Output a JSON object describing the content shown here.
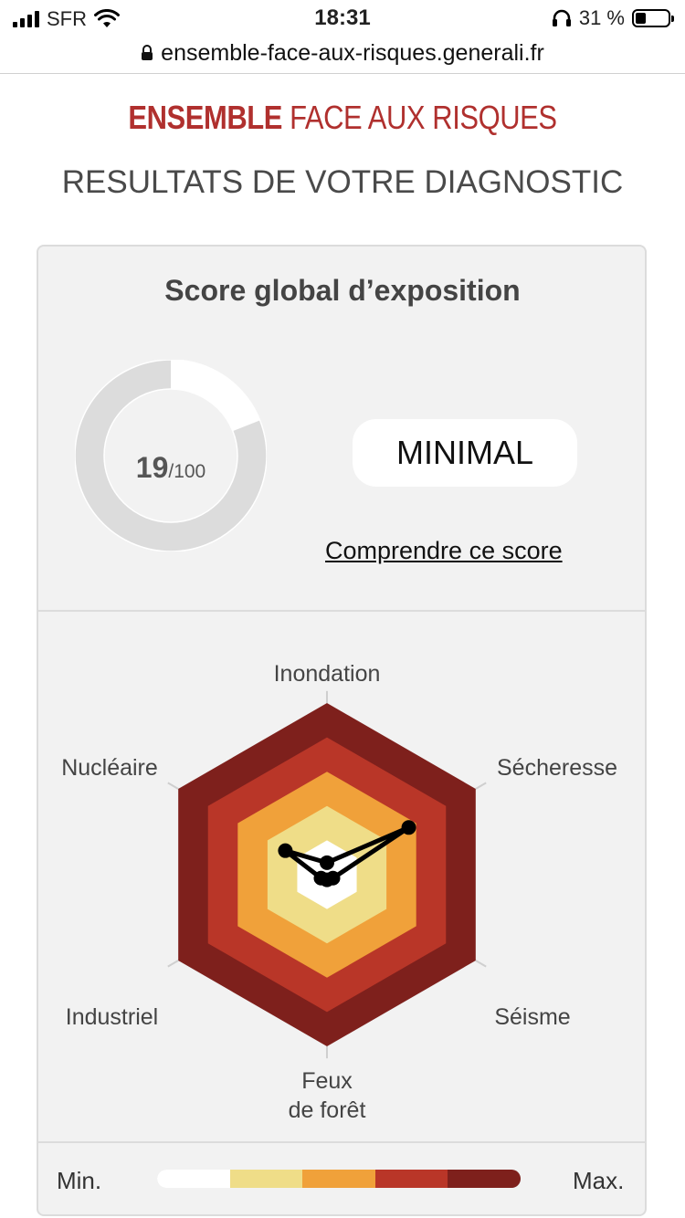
{
  "status_bar": {
    "carrier": "SFR",
    "time": "18:31",
    "battery_percent": "31 %",
    "battery_level": 0.31,
    "icons": [
      "signal-icon",
      "wifi-icon",
      "headphones-icon",
      "battery-icon"
    ]
  },
  "browser": {
    "url": "ensemble-face-aux-risques.generali.fr",
    "lock_icon": "lock-icon"
  },
  "header": {
    "brand_bold": "ENSEMBLE",
    "brand_rest": "FACE AUX RISQUES",
    "subtitle": "RESULTATS DE VOTRE DIAGNOSTIC"
  },
  "score": {
    "title": "Score global d’exposition",
    "value": "19",
    "max": "/100",
    "fraction": 0.19,
    "level": "MINIMAL",
    "link": "Comprendre ce score"
  },
  "radar": {
    "axes": [
      {
        "label": "Inondation",
        "value": 0.07
      },
      {
        "label": "Sécheresse",
        "value": 0.55
      },
      {
        "label": "Séisme",
        "value": 0.04
      },
      {
        "label": "Feux de forêt",
        "value": 0.03
      },
      {
        "label": "Industriel",
        "value": 0.04
      },
      {
        "label": "Nucléaire",
        "value": 0.28
      }
    ],
    "feux_line1": "Feux",
    "feux_line2": "de forêt",
    "bands": [
      "#ffffff",
      "#efdd88",
      "#f0a13a",
      "#b93628",
      "#7e201c"
    ]
  },
  "legend": {
    "min": "Min.",
    "max": "Max.",
    "colors": [
      "#ffffff",
      "#efdd88",
      "#f0a13a",
      "#b93628",
      "#7e201c"
    ]
  },
  "colors": {
    "brand": "#b0302e",
    "gauge_track": "#dcdcdc",
    "gauge_fill": "#ffffff",
    "series": "#000000"
  }
}
